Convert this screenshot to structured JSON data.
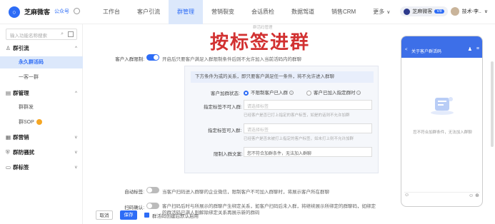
{
  "app": {
    "logo_char": "○",
    "brand": "芝麻微客",
    "account_type": "公众号"
  },
  "nav": {
    "items": [
      {
        "label": "工作台"
      },
      {
        "label": "客户引流"
      },
      {
        "label": "群管理"
      },
      {
        "label": "营销裂变"
      },
      {
        "label": "会话质检"
      },
      {
        "label": "数据驾道"
      },
      {
        "label": "销售CRM"
      },
      {
        "label": "更多"
      }
    ],
    "active_index": 2,
    "more_caret": "∨"
  },
  "top_right": {
    "org_name": "芝麻微客",
    "vip_badge": "V8",
    "user": "技术-李..",
    "caret": "∨"
  },
  "sidebar": {
    "search_placeholder": "输入功能名称搜索",
    "groups": [
      {
        "label": "群引流",
        "icon": "user-icon",
        "expanded": true
      },
      {
        "label": "群管理",
        "icon": "manage-icon",
        "expanded": true
      },
      {
        "label": "群营销",
        "icon": "marketing-icon",
        "expanded": false
      },
      {
        "label": "群防骚扰",
        "icon": "shield-icon",
        "expanded": false
      },
      {
        "label": "群标签",
        "icon": "tag-icon",
        "expanded": false
      }
    ],
    "items": [
      {
        "label": "永久群活码"
      },
      {
        "label": "一客一群"
      },
      {
        "label": "群群发"
      },
      {
        "label": "群SOP"
      }
    ],
    "arrow_up": "^",
    "arrow_down": "v"
  },
  "overlay": {
    "title": "按标签进群",
    "hint": "群活码管理"
  },
  "form": {
    "customer_join_label": "客户入群限制:",
    "customer_join_desc": "开启后只要客户满足入群限制条件后则不允许加入当前活码内的群聊",
    "customer_join_enabled": true,
    "cond_header": "下方条件为或的关系，即只要客户满足任一条件，将不允许进入群聊",
    "join_status_label": "客户加群状态:",
    "join_status_opt1": "不限制客户已入群",
    "join_status_opt2": "客户已加入指定群时",
    "join_status_selected": 0,
    "tag_label": "指定标签不可入群:",
    "tag_placeholder": "请选择标签",
    "tag_hint": "已经客户是否已打上指定的客户标签，如是的话则不允许加群",
    "remark_label": "指定标签可入群:",
    "remark_placeholder": "请选择标签",
    "remark_hint": "已经客户是否未被打上指定的客户标签，如未打上则不允许加群",
    "limit_copy_label": "限制入群文案:",
    "limit_copy_value": "您不符合加群条件，无法加入群聊",
    "auto_tag_label": "自动标签:",
    "auto_tag_desc": "当客户扫码进入群聊的企业微信，限制客户不可加入群聊时，将展示客户所在群聊",
    "auto_tag_enabled": false,
    "scan_label": "扫码确认:",
    "scan_desc": "客户扫码后时与所展示的群聊产生绑定关系，如客户扫码后未入群，将继续展示所绑定的群聊码，如绑定的群活码已满人则解除绑定关系再展示新的群码",
    "scan_enabled": false
  },
  "footer": {
    "cancel": "取消",
    "save": "保存",
    "checkbox_label": "群活码创建后默认启用",
    "checkbox_checked": true
  },
  "phone": {
    "title": "关于客户群活码",
    "back": "<",
    "menu": "≡",
    "user": "♟",
    "empty_text": "您不符合加群条件，无法加入群聊",
    "emoji_left": "☺",
    "emoji_right": "☺ ⊕"
  },
  "colors": {
    "accent": "#2d6cf6",
    "overlay_red": "#d23131",
    "active_bg": "#dce8fb"
  }
}
